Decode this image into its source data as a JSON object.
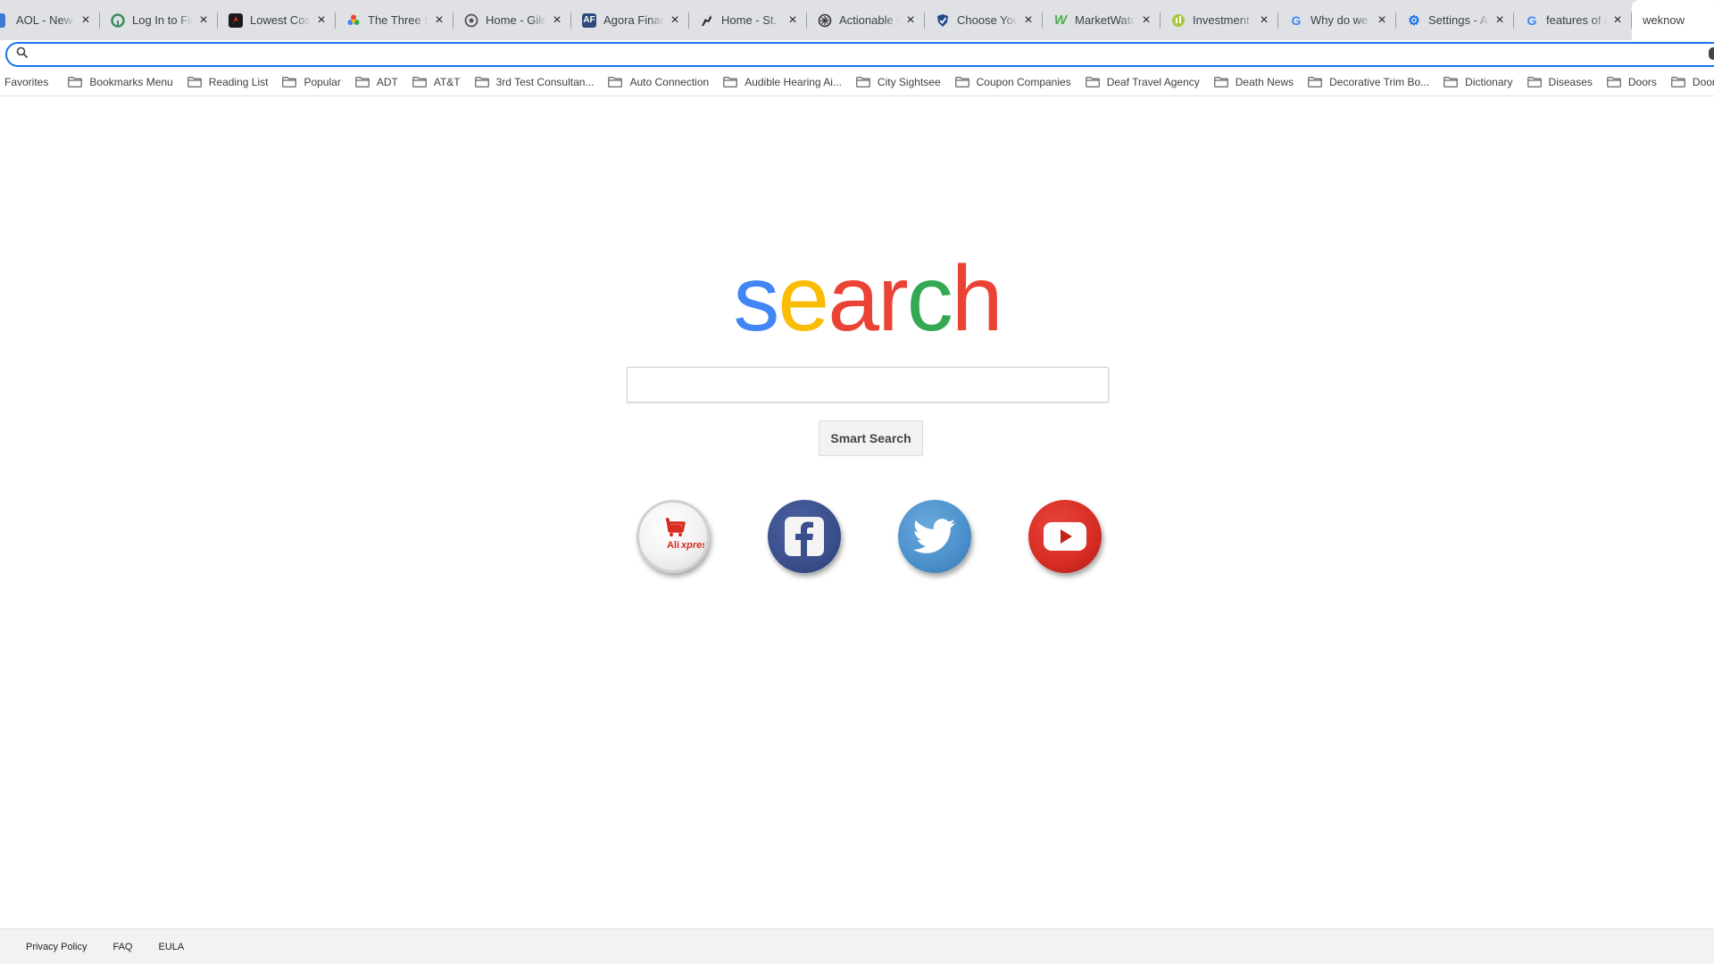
{
  "tabs": [
    {
      "title": "AOL - News, Sports, Weather",
      "icon": "aol-icon"
    },
    {
      "title": "Log In to Fidelity",
      "icon": "fidelity-icon"
    },
    {
      "title": "Lowest Cost",
      "icon": "red-logo-icon"
    },
    {
      "title": "The Three Sisters",
      "icon": "google-photos-icon"
    },
    {
      "title": "Home - Gilded",
      "icon": "gilded-icon"
    },
    {
      "title": "Agora Financial",
      "icon": "agora-icon"
    },
    {
      "title": "Home - St. Paul",
      "icon": "st-paul-icon"
    },
    {
      "title": "Actionable wisdom",
      "icon": "actionable-icon"
    },
    {
      "title": "Choose Your",
      "icon": "checkmark-shield-icon"
    },
    {
      "title": "MarketWatch",
      "icon": "marketwatch-icon"
    },
    {
      "title": "Investment Tools",
      "icon": "investment-icon"
    },
    {
      "title": "Why do we sleep",
      "icon": "google-icon"
    },
    {
      "title": "Settings - About",
      "icon": "settings-gear-icon"
    },
    {
      "title": "features of google",
      "icon": "google-icon"
    }
  ],
  "active_tab": {
    "title": "weknow"
  },
  "omnibox": {
    "value": "",
    "placeholder": ""
  },
  "bookmarks": {
    "favorites_label": "Favorites",
    "folders": [
      "Bookmarks Menu",
      "Reading List",
      "Popular",
      "ADT",
      "AT&T",
      "3rd Test Consultan...",
      "Auto Connection",
      "Audible Hearing Ai...",
      "City Sightsee",
      "Coupon Companies",
      "Deaf Travel Agency",
      "Death News",
      "Decorative Trim Bo...",
      "Dictionary",
      "Diseases",
      "Doors",
      "Door Compa"
    ]
  },
  "logo": {
    "letters": [
      {
        "char": "s",
        "color": "#4285f4"
      },
      {
        "char": "e",
        "color": "#fbbc05"
      },
      {
        "char": "a",
        "color": "#ea4335"
      },
      {
        "char": "r",
        "color": "#ea4335"
      },
      {
        "char": "c",
        "color": "#34a853"
      },
      {
        "char": "h",
        "color": "#ea4335"
      }
    ]
  },
  "search": {
    "value": "",
    "placeholder": "",
    "button_label": "Smart Search"
  },
  "shortcuts": [
    {
      "name": "AliExpress",
      "icon": "aliexpress-icon"
    },
    {
      "name": "Facebook",
      "icon": "facebook-icon"
    },
    {
      "name": "Twitter",
      "icon": "twitter-icon"
    },
    {
      "name": "YouTube",
      "icon": "youtube-icon"
    }
  ],
  "footer": {
    "links": [
      "Privacy Policy",
      "FAQ",
      "EULA"
    ]
  },
  "colors": {
    "tabstrip_bg": "#dfe1e5",
    "omnibox_focus": "#1a73e8",
    "footer_bg": "#f2f2f2"
  }
}
